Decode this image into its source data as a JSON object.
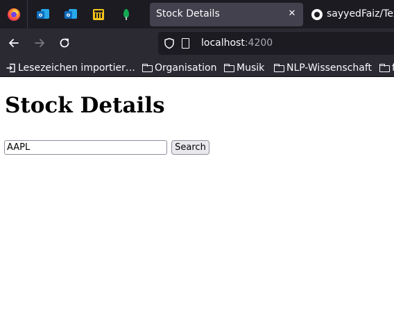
{
  "browser": {
    "pinned_tabs": [
      {
        "icon": "firefox-icon"
      },
      {
        "icon": "outlook-icon"
      },
      {
        "icon": "outlook-icon"
      },
      {
        "icon": "bank-icon"
      },
      {
        "icon": "mongodb-leaf-icon"
      }
    ],
    "active_tab": {
      "title": "Stock Details",
      "close_glyph": "✕"
    },
    "other_tab": {
      "title": "sayyedFaiz/Tex",
      "icon": "github-icon"
    },
    "url": {
      "host": "localhost",
      "port": ":4200"
    },
    "bookmarks": [
      {
        "label": "Lesezeichen importier…",
        "icon": "import-icon"
      },
      {
        "label": "Organisation",
        "icon": "folder-icon"
      },
      {
        "label": "Musik",
        "icon": "folder-icon"
      },
      {
        "label": "NLP-Wissenschaft",
        "icon": "folder-icon"
      },
      {
        "label": "f",
        "icon": "folder-icon"
      }
    ]
  },
  "page": {
    "title": "Stock Details",
    "search": {
      "value": "AAPL",
      "button_label": "Search"
    }
  }
}
